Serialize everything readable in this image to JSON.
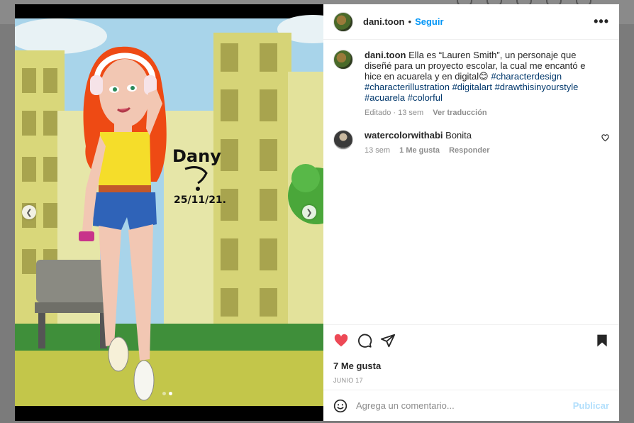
{
  "colors": {
    "accent": "#0095f6",
    "like_red": "#ed4956",
    "hashtag": "#00376b",
    "muted": "#8e8e8e"
  },
  "post": {
    "author": "dani.toon",
    "follow_label": "Seguir",
    "more_icon": "more-horizontal-icon",
    "caption_author": "dani.toon",
    "caption_text": "Ella es “Lauren Smith”, un personaje que diseñé para un proyecto escolar, la cual me encantó e hice en acuarela y en digital😊",
    "hashtags": [
      "#characterdesign",
      "#characterillustration",
      "#digitalart",
      "#drawthisinyourstyle",
      "#acuarela",
      "#colorful"
    ],
    "caption_meta": "Editado · 13 sem",
    "translate_label": "Ver traducción",
    "likes": "7 Me gusta",
    "date": "JUNIO 17"
  },
  "artwork": {
    "signature": "Dany",
    "signature_date": "25/11/21."
  },
  "comments": [
    {
      "user": "watercolorwithabi",
      "text": "Bonita",
      "time": "13 sem",
      "likes": "1 Me gusta",
      "reply": "Responder"
    }
  ],
  "composer": {
    "placeholder": "Agrega un comentario...",
    "publish_label": "Publicar",
    "emoji_icon": "emoji-icon"
  }
}
